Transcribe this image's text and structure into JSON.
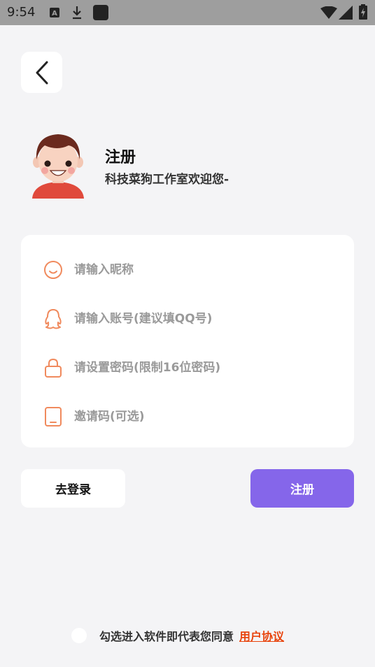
{
  "status_bar": {
    "time": "9:54",
    "icons": [
      "a-badge-icon",
      "download-icon",
      "app-square-icon",
      "wifi-icon",
      "signal-icon",
      "battery-charging-icon"
    ]
  },
  "header": {
    "title": "注册",
    "subtitle": "科技菜狗工作室欢迎您-"
  },
  "form": {
    "nickname": {
      "placeholder": "请输入昵称",
      "value": "",
      "icon": "smile-icon"
    },
    "account": {
      "placeholder": "请输入账号(建议填QQ号)",
      "value": "",
      "icon": "qq-penguin-icon"
    },
    "password": {
      "placeholder": "请设置密码(限制16位密码)",
      "value": "",
      "icon": "lock-icon"
    },
    "invite": {
      "placeholder": "邀请码(可选)",
      "value": "",
      "icon": "tablet-icon"
    }
  },
  "actions": {
    "login_label": "去登录",
    "register_label": "注册"
  },
  "agreement": {
    "text": "勾选进入软件即代表您同意",
    "link": "用户协议"
  },
  "colors": {
    "accent": "#8566ea",
    "icon_orange": "#f08a5d",
    "link": "#e8430c",
    "background": "#f4f4f6"
  }
}
